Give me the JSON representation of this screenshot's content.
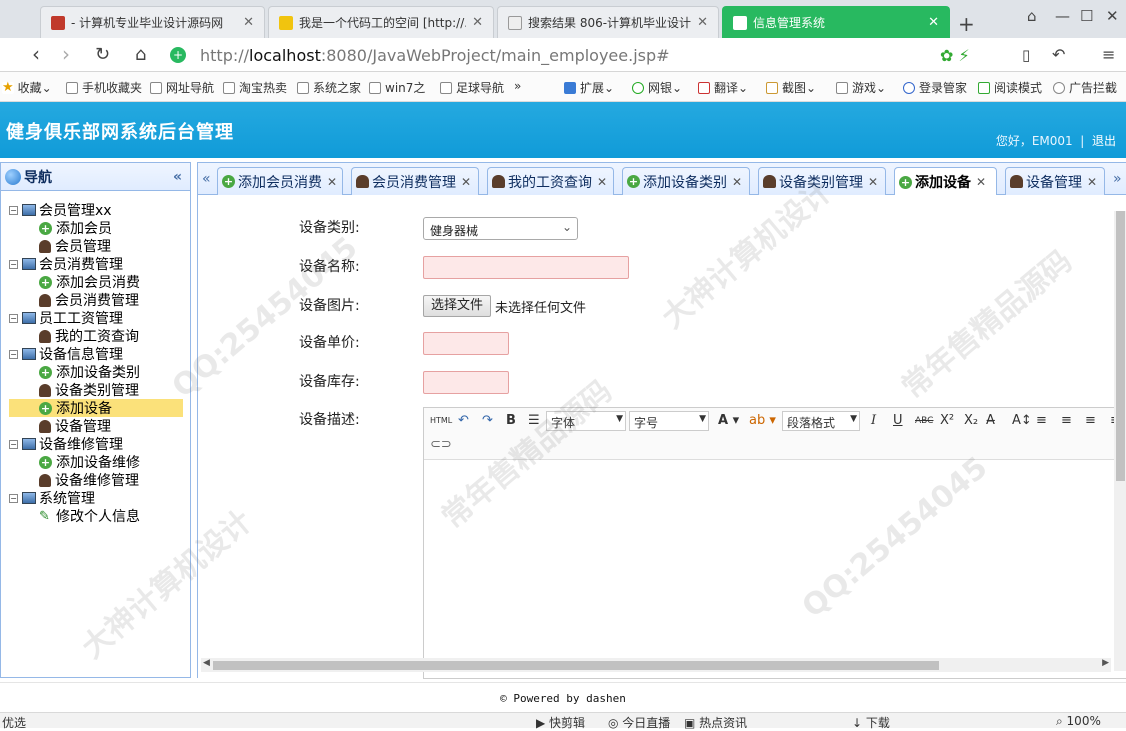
{
  "browser": {
    "tabs": [
      {
        "title": "- 计算机专业毕业设计源码网",
        "color": "#c0392b"
      },
      {
        "title": "我是一个代码工的空间 [http://...",
        "color": "#f1c40f"
      },
      {
        "title": "搜索结果 806-计算机毕业设计...",
        "color": "#95a5a6"
      },
      {
        "title": "信息管理系统",
        "color": "#ffffff"
      }
    ],
    "url_scheme": "http://",
    "url_host": "localhost",
    "url_rest": ":8080/JavaWebProject/main_employee.jsp#",
    "bookmarks": [
      "收藏",
      "手机收藏夹",
      "网址导航",
      "淘宝热卖",
      "系统之家",
      "win7之",
      "足球导航",
      "»",
      "扩展",
      "网银",
      "翻译",
      "截图",
      "游戏",
      "登录管家",
      "阅读模式",
      "广告拦截"
    ]
  },
  "header": {
    "title": "健身俱乐部网系统后台管理",
    "greeting": "您好，EM001",
    "separator": "|",
    "logout": "退出"
  },
  "nav": {
    "title": "导航",
    "collapse": "«",
    "groups": [
      {
        "label": "会员管理xx",
        "children": [
          {
            "label": "添加会员",
            "icon": "plus"
          },
          {
            "label": "会员管理",
            "icon": "person"
          }
        ]
      },
      {
        "label": "会员消费管理",
        "children": [
          {
            "label": "添加会员消费",
            "icon": "plus"
          },
          {
            "label": "会员消费管理",
            "icon": "person"
          }
        ]
      },
      {
        "label": "员工工资管理",
        "children": [
          {
            "label": "我的工资查询",
            "icon": "person"
          }
        ]
      },
      {
        "label": "设备信息管理",
        "children": [
          {
            "label": "添加设备类别",
            "icon": "plus"
          },
          {
            "label": "设备类别管理",
            "icon": "person"
          },
          {
            "label": "添加设备",
            "icon": "plus",
            "selected": true
          },
          {
            "label": "设备管理",
            "icon": "person"
          }
        ]
      },
      {
        "label": "设备维修管理",
        "children": [
          {
            "label": "添加设备维修",
            "icon": "plus"
          },
          {
            "label": "设备维修管理",
            "icon": "person"
          }
        ]
      },
      {
        "label": "系统管理",
        "children": [
          {
            "label": "修改个人信息",
            "icon": "pencil"
          }
        ]
      }
    ]
  },
  "tabs": [
    {
      "label": "添加会员消费",
      "icon": "plus"
    },
    {
      "label": "会员消费管理",
      "icon": "person"
    },
    {
      "label": "我的工资查询",
      "icon": "person"
    },
    {
      "label": "添加设备类别",
      "icon": "plus"
    },
    {
      "label": "设备类别管理",
      "icon": "person"
    },
    {
      "label": "添加设备",
      "icon": "plus",
      "active": true
    },
    {
      "label": "设备管理",
      "icon": "person"
    }
  ],
  "form": {
    "category_label": "设备类别:",
    "category_value": "健身器械",
    "name_label": "设备名称:",
    "name_value": "",
    "image_label": "设备图片:",
    "file_button": "选择文件",
    "file_status": "未选择任何文件",
    "price_label": "设备单价:",
    "price_value": "",
    "stock_label": "设备库存:",
    "stock_value": "",
    "desc_label": "设备描述:"
  },
  "editor": {
    "html": "HTML",
    "font": "字体",
    "size": "字号",
    "format": "段落格式",
    "bold": "B",
    "italic": "I",
    "underline": "U",
    "strike": "ABC"
  },
  "footer": "© Powered by dashen",
  "status": [
    "优选",
    "快剪辑",
    "今日直播",
    "热点资讯",
    "下载",
    "100%"
  ],
  "watermarks": [
    "QQ:25454045",
    "常年售精品源码",
    "大神计算机设计"
  ]
}
